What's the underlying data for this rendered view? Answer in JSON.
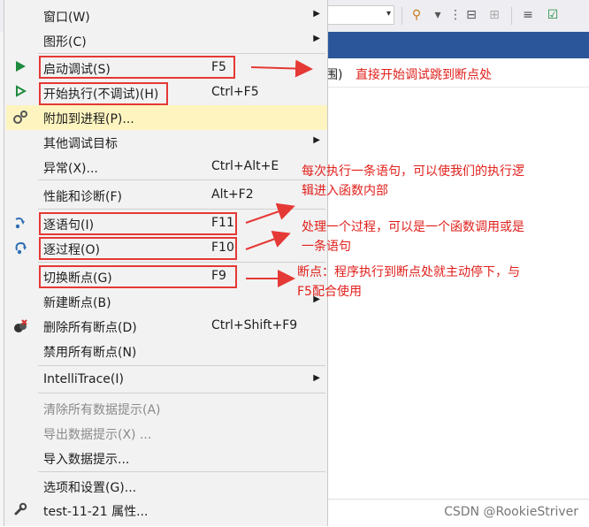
{
  "menu": {
    "items": [
      {
        "label": "窗口(W)",
        "shortcut": "",
        "submenu": true,
        "icon": "",
        "disabled": false
      },
      {
        "label": "图形(C)",
        "shortcut": "",
        "submenu": true,
        "icon": "",
        "disabled": false
      },
      {
        "label": "启动调试(S)",
        "shortcut": "F5",
        "submenu": false,
        "icon": "play-icon",
        "disabled": false
      },
      {
        "label": "开始执行(不调试)(H)",
        "shortcut": "Ctrl+F5",
        "submenu": false,
        "icon": "play-outline-icon",
        "disabled": false
      },
      {
        "label": "附加到进程(P)...",
        "shortcut": "",
        "submenu": false,
        "icon": "gears-icon",
        "disabled": false
      },
      {
        "label": "其他调试目标",
        "shortcut": "",
        "submenu": true,
        "icon": "",
        "disabled": false
      },
      {
        "label": "异常(X)...",
        "shortcut": "Ctrl+Alt+E",
        "submenu": false,
        "icon": "",
        "disabled": false
      },
      {
        "label": "性能和诊断(F)",
        "shortcut": "Alt+F2",
        "submenu": false,
        "icon": "",
        "disabled": false
      },
      {
        "label": "逐语句(I)",
        "shortcut": "F11",
        "submenu": false,
        "icon": "step-into-icon",
        "disabled": false
      },
      {
        "label": "逐过程(O)",
        "shortcut": "F10",
        "submenu": false,
        "icon": "step-over-icon",
        "disabled": false
      },
      {
        "label": "切换断点(G)",
        "shortcut": "F9",
        "submenu": false,
        "icon": "",
        "disabled": false
      },
      {
        "label": "新建断点(B)",
        "shortcut": "",
        "submenu": true,
        "icon": "",
        "disabled": false
      },
      {
        "label": "删除所有断点(D)",
        "shortcut": "Ctrl+Shift+F9",
        "submenu": false,
        "icon": "delete-breakpoints-icon",
        "disabled": false
      },
      {
        "label": "禁用所有断点(N)",
        "shortcut": "",
        "submenu": false,
        "icon": "",
        "disabled": false
      },
      {
        "label": "IntelliTrace(I)",
        "shortcut": "",
        "submenu": true,
        "icon": "",
        "disabled": false
      },
      {
        "label": "清除所有数据提示(A)",
        "shortcut": "",
        "submenu": false,
        "icon": "",
        "disabled": true
      },
      {
        "label": "导出数据提示(X) ...",
        "shortcut": "",
        "submenu": false,
        "icon": "",
        "disabled": true
      },
      {
        "label": "导入数据提示...",
        "shortcut": "",
        "submenu": false,
        "icon": "",
        "disabled": false
      },
      {
        "label": "选项和设置(G)...",
        "shortcut": "",
        "submenu": false,
        "icon": "",
        "disabled": false
      },
      {
        "label": "test-11-21 属性...",
        "shortcut": "",
        "submenu": false,
        "icon": "wrench-icon",
        "disabled": false
      }
    ],
    "submenu_glyph": "▶"
  },
  "background": {
    "doc_fragment": "围)",
    "combo_arrow": "▾"
  },
  "annotations": {
    "a1": "直接开始调试跳到断点处",
    "a2_line1": "每次执行一条语句，可以使我们的执行逻",
    "a2_line2": "辑进入函数内部",
    "a3_line1": "处理一个过程，可以是一个函数调用或是",
    "a3_line2": "一条语句",
    "a4_line1": "断点：程序执行到断点处就主动停下，与",
    "a4_line2": "F5配合使用"
  },
  "watermark": "CSDN @RookieStriver",
  "colors": {
    "annotation": "#e0201c",
    "highlight_border": "#e53935",
    "hover": "#fdf4bf",
    "accent_blue": "#2b579a",
    "play_green": "#1e8a3e"
  }
}
